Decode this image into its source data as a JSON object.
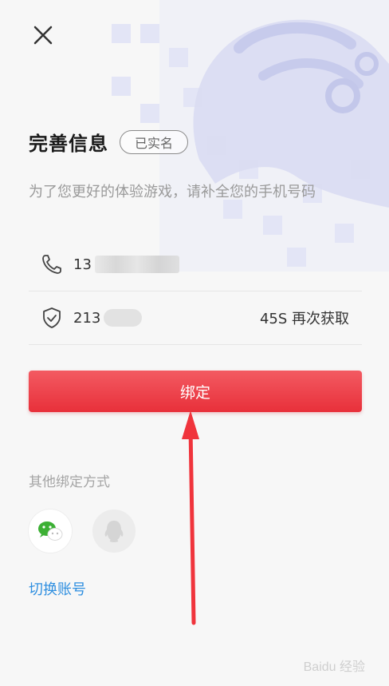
{
  "header": {
    "title": "完善信息",
    "badge": "已实名"
  },
  "subtitle": "为了您更好的体验游戏，请补全您的手机号码",
  "form": {
    "phone_value": "13",
    "code_value": "213",
    "resend_label": "45S 再次获取"
  },
  "bind_button_label": "绑定",
  "other_methods": {
    "label": "其他绑定方式",
    "options": [
      "wechat-icon",
      "qq-icon"
    ]
  },
  "switch_account_label": "切换账号",
  "watermark": "Baidu 经验",
  "colors": {
    "primary_button": "#e8303a",
    "link": "#2f8fe0",
    "annotation_arrow": "#f0343c",
    "bg_art": "#dfe2f4"
  }
}
